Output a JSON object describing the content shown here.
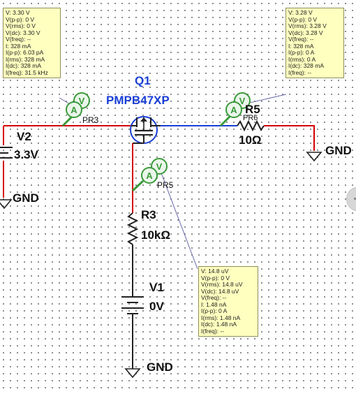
{
  "components": {
    "q1": {
      "ref": "Q1",
      "part": "PMPB47XP"
    },
    "v2": {
      "ref": "V2",
      "value": "3.3V"
    },
    "r5": {
      "ref": "R5",
      "value": "10Ω"
    },
    "r3": {
      "ref": "R3",
      "value": "10kΩ"
    },
    "v1": {
      "ref": "V1",
      "value": "0V"
    }
  },
  "grounds": {
    "left": "GND",
    "right": "GND",
    "bottom": "GND"
  },
  "probes": {
    "pr3": {
      "label": "PR3",
      "v": "V",
      "a": "A"
    },
    "pr6": {
      "label": "PR6",
      "v": "V",
      "a": "A"
    },
    "pr5": {
      "label": "PR5",
      "v": "V",
      "a": "A"
    }
  },
  "tooltips": {
    "pr3": [
      "V: 3.30 V",
      "V(p-p): 0 V",
      "V(rms): 0 V",
      "V(dc): 3.30 V",
      "V(freq): --",
      "I: 328 mA",
      "I(p-p): 6.03 pA",
      "I(rms): 328 mA",
      "I(dc): 328 mA",
      "I(freq): 31.5 kHz"
    ],
    "pr6": [
      "V: 3.28 V",
      "V(p-p): 0 V",
      "V(rms): 3.28 V",
      "V(dc): 3.28 V",
      "V(freq): --",
      "I: 328 mA",
      "I(p-p): 0 A",
      "I(rms): 0 A",
      "I(dc): 328 mA",
      "I(freq): --"
    ],
    "pr5": [
      "V: 14.8 uV",
      "V(p-p): 0 V",
      "V(rms): 14.8 uV",
      "V(dc): 14.8 uV",
      "V(freq): --",
      "I: 1.48 nA",
      "I(p-p): 0 A",
      "I(rms): 1.48 nA",
      "I(dc): 1.48 nA",
      "I(freq): --"
    ]
  },
  "colors": {
    "wire_red": "#d40000",
    "wire_blue": "#1a3fd6",
    "wire_dark": "#222222",
    "probe_green": "#3a9a3a",
    "tooltip_bg": "#ffffbf"
  }
}
